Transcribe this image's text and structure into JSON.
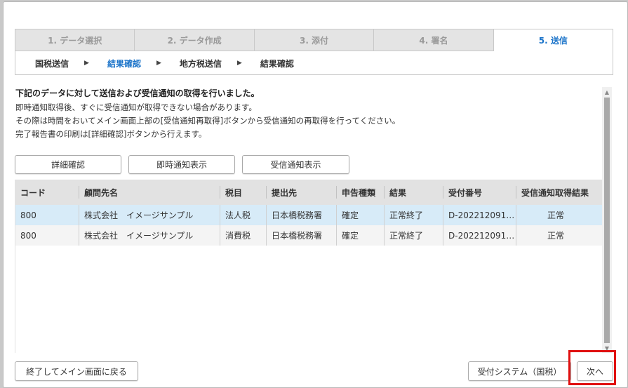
{
  "wizard": {
    "steps": [
      {
        "label": "1. データ選択"
      },
      {
        "label": "2. データ作成"
      },
      {
        "label": "3. 添付"
      },
      {
        "label": "4. 署名"
      },
      {
        "label": "5. 送信"
      }
    ],
    "substeps": [
      "国税送信",
      "結果確認",
      "地方税送信",
      "結果確認"
    ],
    "active_step": "5. 送信",
    "active_substep": "結果確認"
  },
  "message": {
    "title": "下記のデータに対して送信および受信通知の取得を行いました。",
    "lines": [
      "即時通知取得後、すぐに受信通知が取得できない場合があります。",
      "その際は時間をおいてメイン画面上部の[受信通知再取得]ボタンから受信通知の再取得を行ってください。",
      "完了報告書の印刷は[詳細確認]ボタンから行えます。"
    ]
  },
  "actions": {
    "detail": "詳細確認",
    "immediate": "即時通知表示",
    "receipt": "受信通知表示"
  },
  "table": {
    "headers": [
      "コード",
      "顧問先名",
      "税目",
      "提出先",
      "申告種類",
      "結果",
      "受付番号",
      "受信通知取得結果"
    ],
    "rows": [
      [
        "800",
        "株式会社　イメージサンプル",
        "法人税",
        "日本橋税務署",
        "確定",
        "正常終了",
        "D-202212091…",
        "正常"
      ],
      [
        "800",
        "株式会社　イメージサンプル",
        "消費税",
        "日本橋税務署",
        "確定",
        "正常終了",
        "D-202212091…",
        "正常"
      ]
    ]
  },
  "footer": {
    "back": "終了してメイン画面に戻る",
    "reception": "受付システム（国税）",
    "next": "次へ"
  },
  "colors": {
    "accent": "#1a73c9",
    "selected_row": "#d7ebf8",
    "highlight": "#e01010"
  }
}
